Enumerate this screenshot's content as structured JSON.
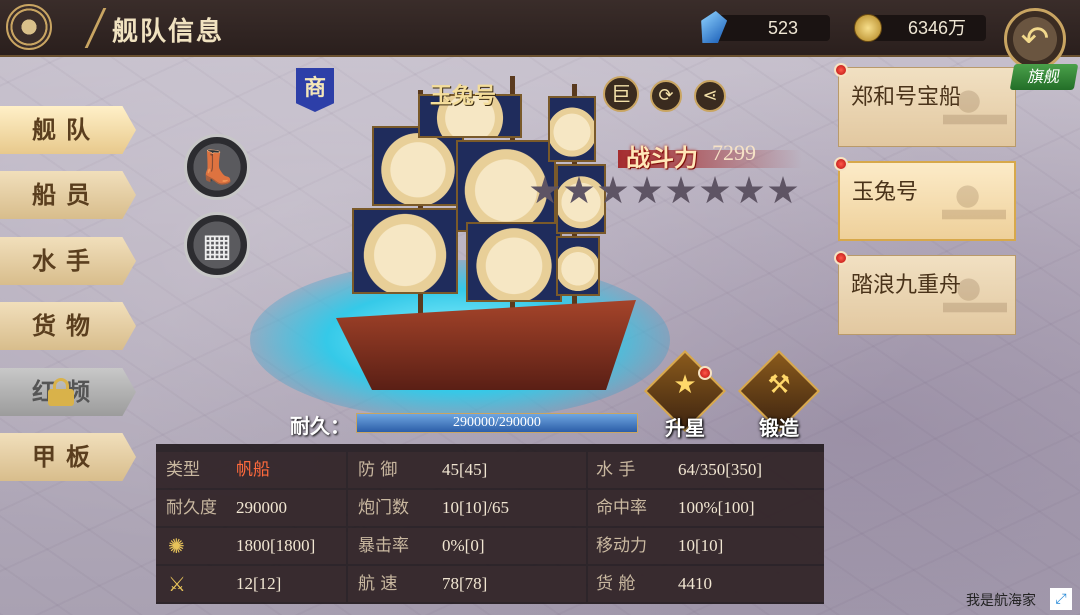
{
  "header": {
    "title": "舰队信息",
    "gems": "523",
    "gold": "6346万"
  },
  "tabs": [
    {
      "label": "舰队",
      "active": true
    },
    {
      "label": "船员"
    },
    {
      "label": "水手"
    },
    {
      "label": "货物"
    },
    {
      "label": "红频",
      "locked": true
    },
    {
      "label": "甲板"
    }
  ],
  "ship": {
    "name": "玉兔号",
    "type_badge": "商",
    "size_badge": "巨",
    "power_label": "战斗力",
    "power_value": "7299",
    "stars_total": 8,
    "stars_filled": 0,
    "durability_label": "耐久：",
    "durability_text": "290000/290000",
    "durability_ratio": 1.0
  },
  "actions": {
    "upgrade_star": "升星",
    "forge": "锻造"
  },
  "stats": {
    "type_label": "类型",
    "type_value": "帆船",
    "durability_label": "耐久度",
    "durability_value": "290000",
    "cannon_power_value": "1800[1800]",
    "melee_value": "12[12]",
    "defense_label": "防 御",
    "defense_value": "45[45]",
    "gunports_label": "炮门数",
    "gunports_value": "10[10]/65",
    "crit_label": "暴击率",
    "crit_value": "0%[0]",
    "speed_label": "航 速",
    "speed_value": "78[78]",
    "sailors_label": "水 手",
    "sailors_value": "64/350[350]",
    "accuracy_label": "命中率",
    "accuracy_value": "100%[100]",
    "mobility_label": "移动力",
    "mobility_value": "10[10]",
    "cargo_label": "货 舱",
    "cargo_value": "4410"
  },
  "fleet_list": {
    "flag_tag": "旗舰",
    "ships": [
      {
        "name": "郑和号宝船"
      },
      {
        "name": "玉兔号",
        "selected": true
      },
      {
        "name": "踏浪九重舟"
      }
    ]
  },
  "watermark": "我是航海家",
  "colors": {
    "accent_gold": "#c9a562",
    "power_red": "#a1140e",
    "sea_cyan": "#35c9e8",
    "flag_green": "#2f8a35"
  },
  "icons": [
    "ship-wheel-icon",
    "gem-icon",
    "coin-icon",
    "back-arrow-icon",
    "boot-icon",
    "cargo-boxes-icon",
    "lock-icon",
    "refresh-icon",
    "share-icon",
    "star-icon",
    "anvil-icon",
    "cannon-icon",
    "crossed-swords-icon",
    "expand-icon"
  ]
}
